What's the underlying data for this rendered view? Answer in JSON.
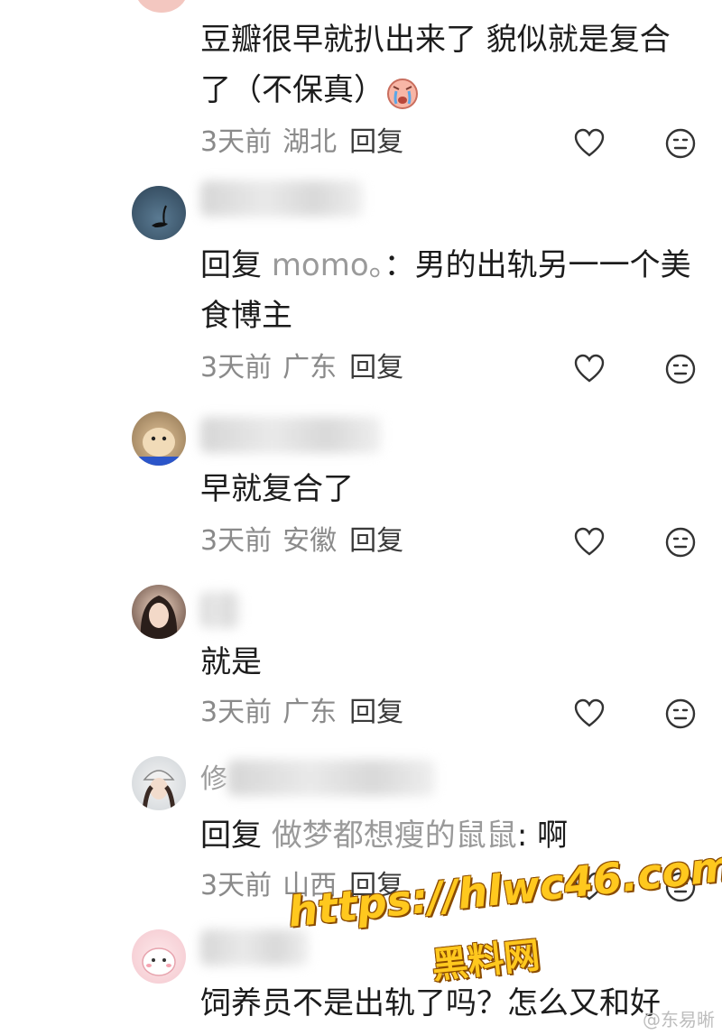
{
  "comments": [
    {
      "text": "豆瓣很早就扒出来了 貌似就是复合了（不保真）",
      "time": "3天前",
      "location": "湖北",
      "reply_label": "回复"
    },
    {
      "reply_prefix": "回复",
      "reply_to": "momo。",
      "text": "：男的出轨另一一个美食博主",
      "time": "3天前",
      "location": "广东",
      "reply_label": "回复"
    },
    {
      "text": "早就复合了",
      "time": "3天前",
      "location": "安徽",
      "reply_label": "回复"
    },
    {
      "text": "就是",
      "time": "3天前",
      "location": "广东",
      "reply_label": "回复"
    },
    {
      "name_fragment": "修",
      "reply_prefix": "回复",
      "reply_to": "做梦都想瘦的鼠鼠",
      "text": ": 啊",
      "time": "3天前",
      "location": "山西",
      "reply_label": "回复"
    },
    {
      "text": "饲养员不是出轨了吗？怎么又和好"
    }
  ],
  "watermark": {
    "url": "https://hlwc46.com",
    "label": "黑料网"
  },
  "credit": "@东易晰",
  "colors": {
    "meta": "#8a8a8a",
    "reply_target": "#9a9a9a",
    "watermark": "#ffc81e"
  }
}
